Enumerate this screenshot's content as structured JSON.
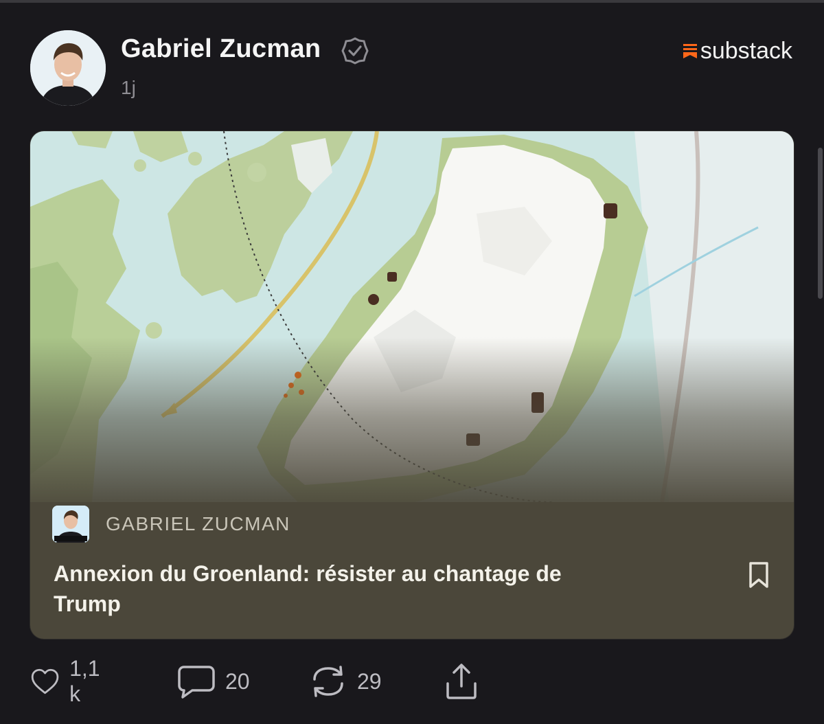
{
  "author": {
    "name": "Gabriel Zucman",
    "time_ago": "1j",
    "avatar_icon": "avatar",
    "verified_icon": "verified-badge-icon"
  },
  "brand": {
    "name": "substack",
    "accent": "#ff6719"
  },
  "post": {
    "publication_name": "GABRIEL ZUCMAN",
    "publication_icon_caption": "Gabriel Zucman",
    "title": "Annexion du Groenland: résister au chantage de Trump",
    "image_description_icon": "greenland-map-image"
  },
  "actions": {
    "likes": "1,1 k",
    "comments": "20",
    "restacks": "29"
  },
  "colors": {
    "background": "#19181c",
    "card": "#4b473a",
    "map_water": "#cfe8e6",
    "map_land": "#c7d7a6"
  }
}
